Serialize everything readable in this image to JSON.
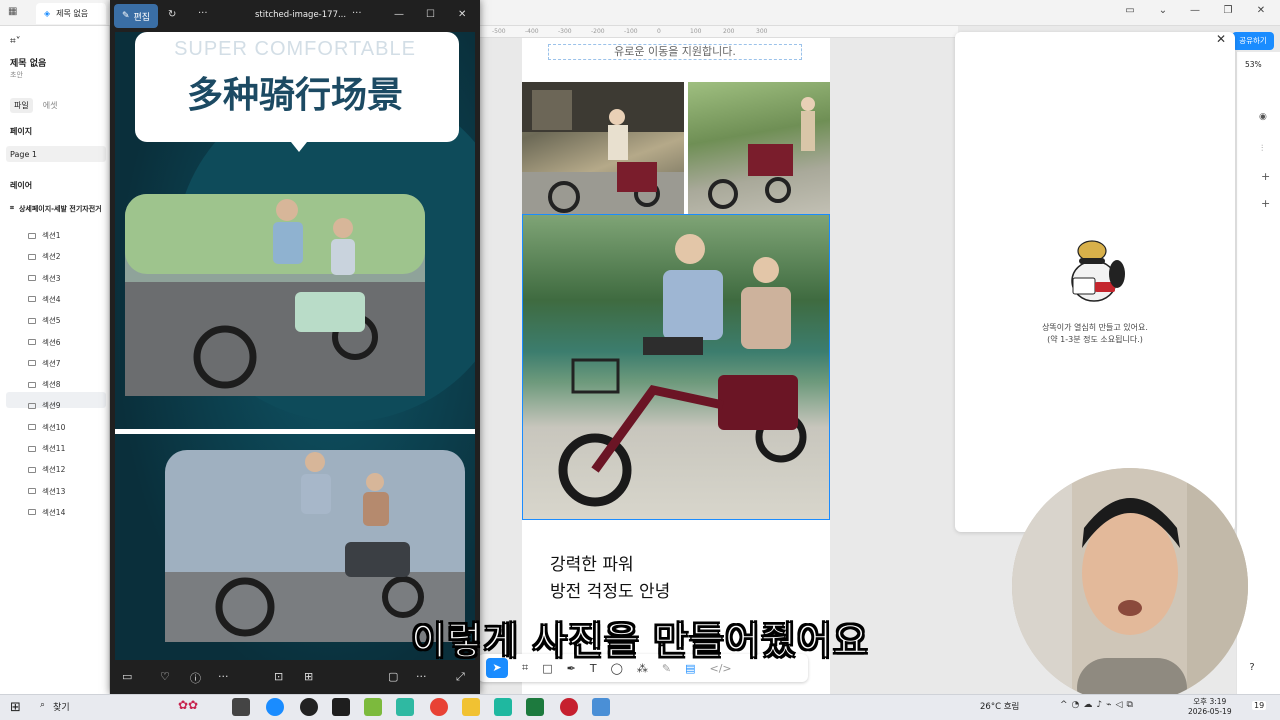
{
  "figma": {
    "tab_title": "제목 없음",
    "file_name": "제목 없음",
    "file_status": "초안",
    "tabs": [
      "파일",
      "에셋"
    ],
    "pages_header": "페이지",
    "page_item": "Page 1",
    "layers_header": "레이어",
    "root_layer": "상세페이지-세발 전기자전거",
    "layers": [
      "섹션1",
      "섹션2",
      "섹션3",
      "섹션4",
      "섹션5",
      "섹션6",
      "섹션7",
      "섹션8",
      "섹션9",
      "섹션10",
      "섹션11",
      "섹션12",
      "섹션13",
      "섹션14"
    ],
    "selected_layer": "섹션9",
    "share_label": "공유하기",
    "zoom": "53%",
    "ruler_ticks": [
      "-500",
      "-400",
      "-300",
      "-200",
      "-100",
      "0",
      "100",
      "200",
      "300"
    ],
    "canvas_text_top": "유로운 이동을 지원합니다.",
    "canvas_title_1": "강력한 파워",
    "canvas_title_2": "방전 걱정도 안녕"
  },
  "plugin": {
    "message_1": "상똑이가 열심히 만들고 있어요.",
    "message_2": "(약 1-3분 정도 소요됩니다.)"
  },
  "viewer": {
    "edit_label": "편집",
    "file_name": "stitched-image-177...",
    "banner_en": "SUPER COMFORTABLE",
    "banner_cn": "多种骑行场景"
  },
  "subtitle": "이렇게 사진을 만들어줬어요",
  "taskbar": {
    "search_label": "찾기",
    "weather": "26°C  흐림",
    "time": "오후 3:19",
    "date": "2026-05-19",
    "notif_count": "19"
  },
  "colors": {
    "accent": "#1a8cff",
    "viewer_bg": "#202020",
    "banner_teal": "#0c3543"
  }
}
